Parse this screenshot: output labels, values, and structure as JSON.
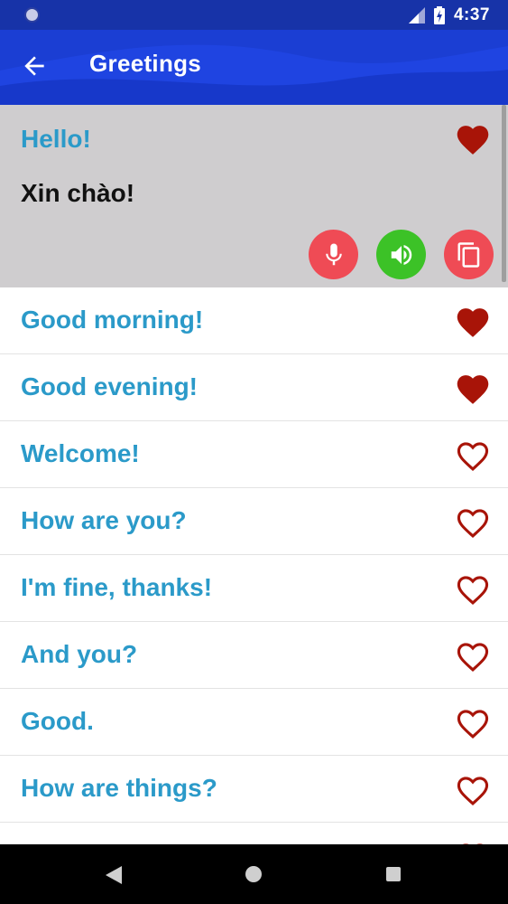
{
  "status_bar": {
    "time": "4:37",
    "icons": [
      "notification-dot-icon",
      "signal-icon",
      "battery-icon"
    ]
  },
  "app_bar": {
    "title": "Greetings",
    "back_icon": "arrow-left-icon"
  },
  "colors": {
    "status_bar": "#1733a8",
    "app_bar": "#1b3ed3",
    "phrase_text": "#2b9ac9",
    "heart": "#a81408",
    "expanded_bg": "#cfcdcf",
    "mic_button": "#ef4b55",
    "speaker_button": "#3cc227",
    "copy_button": "#ef4b55"
  },
  "expanded_item": {
    "phrase": "Hello!",
    "translation": "Xin chào!",
    "favorite": true,
    "actions": [
      "microphone-icon",
      "speaker-icon",
      "copy-icon"
    ]
  },
  "phrases": [
    {
      "text": "Good morning!",
      "favorite": true
    },
    {
      "text": "Good evening!",
      "favorite": true
    },
    {
      "text": "Welcome!",
      "favorite": false
    },
    {
      "text": "How are you?",
      "favorite": false
    },
    {
      "text": "I'm fine, thanks!",
      "favorite": false
    },
    {
      "text": "And you?",
      "favorite": false
    },
    {
      "text": "Good.",
      "favorite": false
    },
    {
      "text": "How are things?",
      "favorite": false
    }
  ],
  "nav_bar": {
    "icons": [
      "nav-back-icon",
      "nav-home-icon",
      "nav-recents-icon"
    ]
  }
}
